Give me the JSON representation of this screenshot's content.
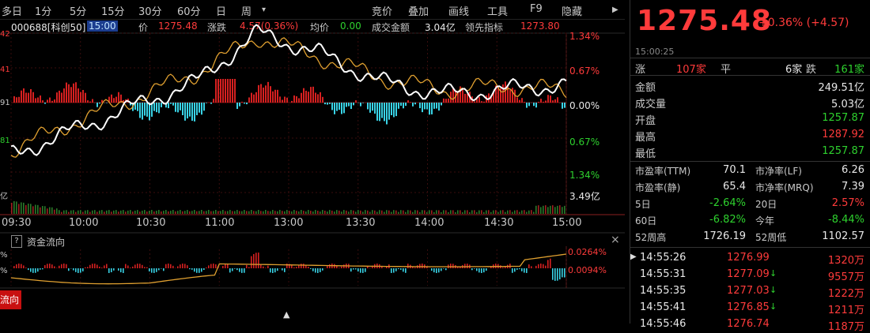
{
  "toolbar": {
    "tabs": [
      "多日",
      "1分",
      "5分",
      "15分",
      "30分",
      "60分",
      "日",
      "周",
      "▾"
    ],
    "right_items": [
      "竞价",
      "叠加",
      "画线",
      "工具",
      "F9",
      "隐藏"
    ],
    "hide_arrow": "▶"
  },
  "info": {
    "code": "000688[科创50]",
    "time": "15:00",
    "price_label": "价",
    "price": "1275.48",
    "change_label": "涨跌",
    "change": "4.57(0.36%)",
    "avg_label": "均价",
    "avg": "0.00",
    "volume_label": "成交金额",
    "volume": "3.04亿",
    "lead_label": "领先指标",
    "lead": "1273.80"
  },
  "chart_axes": {
    "left_top": "42",
    "left_mid1": "41",
    "left_mid2": "91",
    "left_low": "81",
    "left_bottom": "亿",
    "right_top": "1.34%",
    "right_mid1": "0.67%",
    "right_zero": "0.00%",
    "right_mid2": "0.67%",
    "right_low": "1.34%",
    "right_vol": "3.49亿",
    "xticks": [
      "09:30",
      "10:00",
      "10:30",
      "11:00",
      "13:00",
      "13:30",
      "14:00",
      "14:30",
      "15:00"
    ]
  },
  "flow": {
    "help": "?",
    "title": "资金流向",
    "close": "×",
    "right_top": "0.0264%",
    "right_low": "0.0094%",
    "left_labels": [
      "%",
      "%"
    ],
    "tab": "流向",
    "collapse": "▲"
  },
  "quote": {
    "price": "1275.48",
    "change": "+0.36% (+4.57)",
    "time": "15:00:25",
    "up_label": "涨",
    "up_count": "107家",
    "flat_label": "平",
    "flat_count": "6家",
    "down_label": "跌",
    "down_count": "161家",
    "stats": [
      {
        "label": "金额",
        "value": "249.51亿",
        "color": "#e8e8e8"
      },
      {
        "label": "成交量",
        "value": "5.03亿",
        "color": "#e8e8e8"
      },
      {
        "label": "开盘",
        "value": "1257.87",
        "color": "#2ed12e"
      },
      {
        "label": "最高",
        "value": "1287.92",
        "color": "#ff3b3b"
      },
      {
        "label": "最低",
        "value": "1257.87",
        "color": "#2ed12e"
      }
    ],
    "ratios": [
      {
        "l1": "市盈率(TTM)",
        "v1": "70.1",
        "l2": "市净率(LF)",
        "v2": "6.26",
        "c1": "#e8e8e8",
        "c2": "#e8e8e8"
      },
      {
        "l1": "市盈率(静)",
        "v1": "65.4",
        "l2": "市净率(MRQ)",
        "v2": "7.39",
        "c1": "#e8e8e8",
        "c2": "#e8e8e8"
      },
      {
        "l1": "5日",
        "v1": "-2.64%",
        "l2": "20日",
        "v2": "2.57%",
        "c1": "#2ed12e",
        "c2": "#ff3b3b"
      },
      {
        "l1": "60日",
        "v1": "-6.82%",
        "l2": "今年",
        "v2": "-8.44%",
        "c1": "#2ed12e",
        "c2": "#2ed12e"
      },
      {
        "l1": "52周高",
        "v1": "1726.19",
        "l2": "52周低",
        "v2": "1102.57",
        "c1": "#e8e8e8",
        "c2": "#e8e8e8"
      }
    ],
    "ticks": [
      {
        "time": "14:55:26",
        "price": "1276.99",
        "vol": "1320万",
        "arrow": ""
      },
      {
        "time": "14:55:31",
        "price": "1277.09",
        "vol": "9557万",
        "arrow": "↓"
      },
      {
        "time": "14:55:35",
        "price": "1277.03",
        "vol": "1222万",
        "arrow": "↓"
      },
      {
        "time": "14:55:41",
        "price": "1276.85",
        "vol": "1211万",
        "arrow": "↓"
      },
      {
        "time": "14:55:46",
        "price": "1276.74",
        "vol": "1187万",
        "arrow": ""
      }
    ],
    "ticks_arrow": "▶"
  },
  "colors": {
    "up": "#ff3b3b",
    "down": "#2ed12e",
    "price_line": "#ffffff",
    "lead_line": "#e0a030",
    "flow_neg": "#39d3e6",
    "bg": "#000000",
    "accent_tab": "#c81010"
  },
  "chart_data": [
    {
      "type": "line",
      "title": "",
      "x": [
        "09:30",
        "10:00",
        "10:30",
        "11:00",
        "11:30/13:00",
        "13:30",
        "14:00",
        "14:30",
        "15:00"
      ],
      "series": [
        {
          "values": [
            1258,
            1264,
            1270,
            1276,
            1288,
            1283,
            1276,
            1273,
            1274,
            1275.48
          ]
        },
        {
          "values": [
            1259,
            1266,
            1272,
            1278,
            1287,
            1282,
            1277,
            1274,
            1275,
            1273.8
          ]
        }
      ],
      "ylim_pct": [
        -1.34,
        1.34
      ],
      "grid": true
    }
  ]
}
